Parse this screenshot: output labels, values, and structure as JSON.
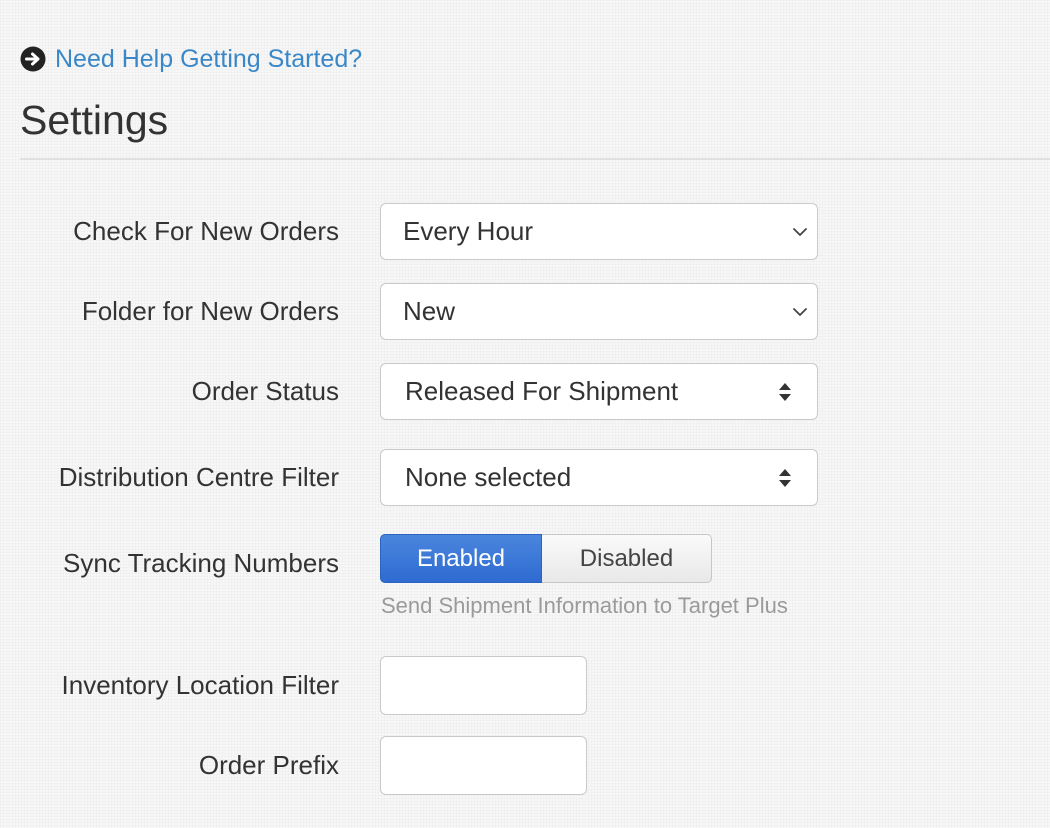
{
  "help": {
    "link_text": "Need Help Getting Started?",
    "icon": "arrow-circle-right-icon"
  },
  "page": {
    "title": "Settings"
  },
  "form": {
    "check_new_orders": {
      "label": "Check For New Orders",
      "value": "Every Hour"
    },
    "folder_new_orders": {
      "label": "Folder for New Orders",
      "value": "New"
    },
    "order_status": {
      "label": "Order Status",
      "value": "Released For Shipment"
    },
    "distribution_filter": {
      "label": "Distribution Centre Filter",
      "value": "None selected"
    },
    "sync_tracking": {
      "label": "Sync Tracking Numbers",
      "enabled_label": "Enabled",
      "disabled_label": "Disabled",
      "selected": "Enabled",
      "help_text": "Send Shipment Information to Target Plus"
    },
    "inventory_filter": {
      "label": "Inventory Location Filter",
      "value": ""
    },
    "order_prefix": {
      "label": "Order Prefix",
      "value": ""
    }
  },
  "colors": {
    "link": "#3a87c8",
    "toggle_active": "#2f6bd1"
  }
}
